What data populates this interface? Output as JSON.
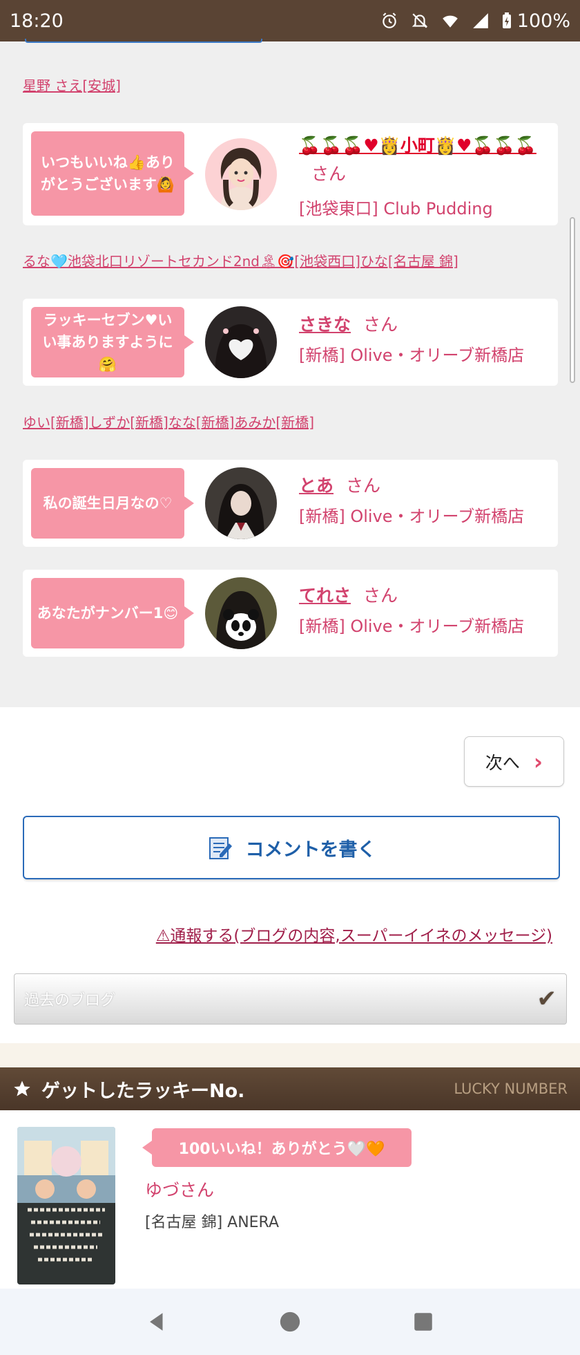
{
  "status": {
    "time": "18:20",
    "battery": "100%"
  },
  "likes": [
    {
      "liked_by_text": "星野 さえ[安城]",
      "message": "いつもいいね👍ありがとうございます🙆",
      "username": "🍒🍒🍒♥👸小町👸♥🍒🍒🍒",
      "san": "さん",
      "shop": "[池袋東口] Club Pudding"
    },
    {
      "liked_by_text": "るな🩵池袋北口リゾートセカンド2nd🏝🎯[池袋西口]ひな[名古屋 錦]",
      "message": "ラッキーセブン♥いい事ありますように🤗",
      "username": "さきな",
      "san": "さん",
      "shop": "[新橋] Olive・オリーブ新橋店"
    },
    {
      "liked_by_text": "ゆい[新橋]しずか[新橋]なな[新橋]あみか[新橋]",
      "message": "私の誕生日月なの♡",
      "username": "とあ",
      "san": "さん",
      "shop": "[新橋] Olive・オリーブ新橋店"
    },
    {
      "liked_by_text": "",
      "message": "あなたがナンバー1😊",
      "username": "てれさ",
      "san": "さん",
      "shop": "[新橋] Olive・オリーブ新橋店"
    }
  ],
  "next_button": {
    "label": "次へ",
    "icon": "chevron-right-icon"
  },
  "comment_button": {
    "label": "コメントを書く",
    "icon": "edit-note-icon"
  },
  "report_link": "⚠通報する(ブログの内容,スーパーイイネのメッセージ)",
  "past_blog_select": {
    "label": "過去のブログ",
    "icon": "check-chevron-icon"
  },
  "lucky_section": {
    "title": "ゲットしたラッキーNo.",
    "subtitle": "LUCKY NUMBER",
    "message": "100いいね！ありがとう🤍🧡",
    "name": "ゆづさん",
    "shop": "[名古屋 錦] ANERA"
  },
  "colors": {
    "accent_pink": "#f696a6",
    "link_pink": "#d2436e",
    "brown": "#5a4434",
    "blue": "#1e5fa8"
  }
}
